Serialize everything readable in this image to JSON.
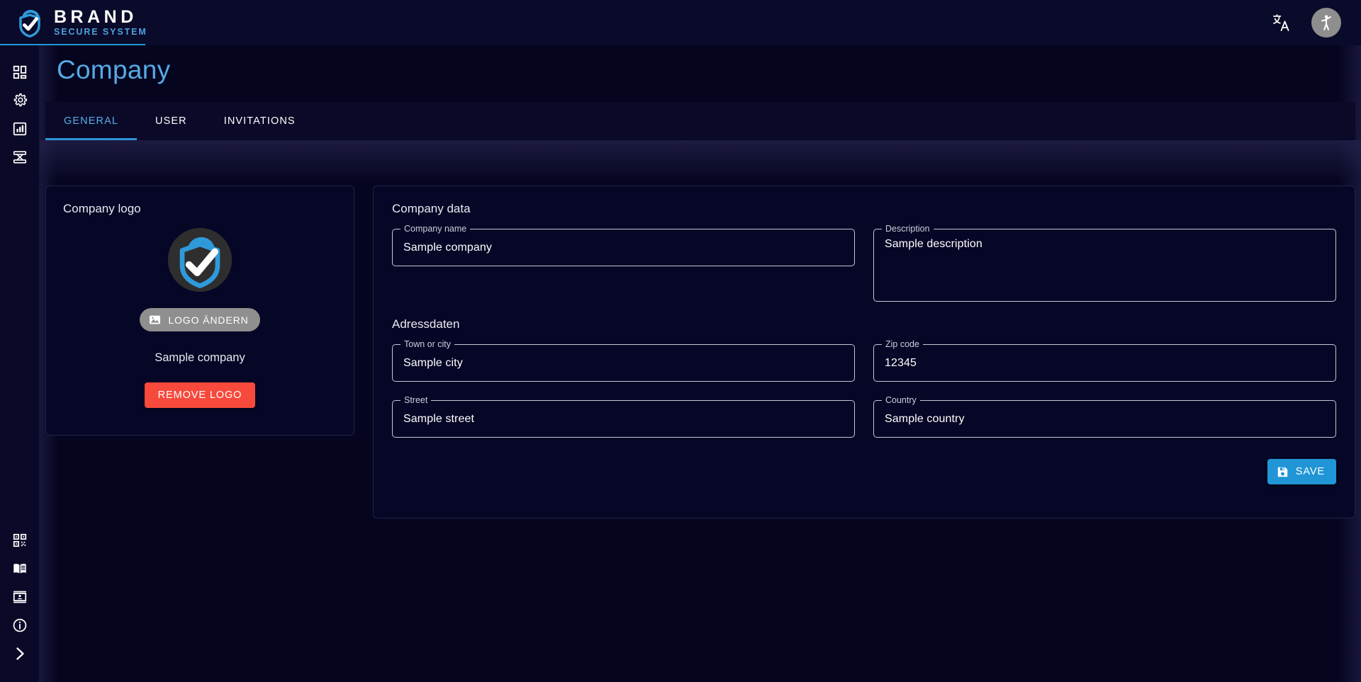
{
  "brand": {
    "name": "BRAND",
    "subtitle": "SECURE SYSTEM",
    "logo_icon": "shield-check-logo"
  },
  "topbar": {
    "translate_icon": "translate-icon",
    "accessibility_icon": "accessibility-icon"
  },
  "sidebar": {
    "top_items": [
      {
        "icon": "dashboard-grid-icon",
        "name": "dashboard"
      },
      {
        "icon": "gear-icon",
        "name": "settings"
      },
      {
        "icon": "bar-chart-icon",
        "name": "reports"
      },
      {
        "icon": "network-topology-icon",
        "name": "network"
      }
    ],
    "bottom_items": [
      {
        "icon": "qr-code-icon",
        "name": "qr-code"
      },
      {
        "icon": "book-icon",
        "name": "documentation"
      },
      {
        "icon": "contact-card-icon",
        "name": "contacts"
      },
      {
        "icon": "info-circle-icon",
        "name": "info"
      },
      {
        "icon": "chevron-right-icon",
        "name": "expand-sidebar"
      }
    ]
  },
  "page": {
    "title": "Company"
  },
  "tabs": [
    {
      "label": "GENERAL",
      "active": true
    },
    {
      "label": "USER",
      "active": false
    },
    {
      "label": "INVITATIONS",
      "active": false
    }
  ],
  "logo_card": {
    "heading": "Company logo",
    "logo_icon": "shield-check-logo",
    "change_logo_label": "LOGO ÄNDERN",
    "change_logo_icon": "image-icon",
    "company_name": "Sample company",
    "remove_logo_label": "REMOVE LOGO"
  },
  "company_data": {
    "heading": "Company data",
    "fields": [
      {
        "label": "Company name",
        "value": "Sample company",
        "placeholder": ""
      },
      {
        "label": "Description",
        "value": "Sample description",
        "placeholder": ""
      }
    ]
  },
  "address_data": {
    "heading": "Adressdaten",
    "fields": [
      {
        "label": "Town or city",
        "value": "Sample city",
        "placeholder": ""
      },
      {
        "label": "Zip code",
        "value": "12345",
        "placeholder": ""
      },
      {
        "label": "Street",
        "value": "Sample street",
        "placeholder": ""
      },
      {
        "label": "Country",
        "value": "Sample country",
        "placeholder": ""
      }
    ]
  },
  "actions": {
    "save_label": "SAVE",
    "save_icon": "save-floppy-icon"
  },
  "colors": {
    "accent_blue": "#2196d6",
    "title_blue": "#57a9e4",
    "danger_red": "#f74a3c",
    "neutral_gray": "#8f8f8f",
    "background": "#05051f",
    "panel": "#060626"
  }
}
